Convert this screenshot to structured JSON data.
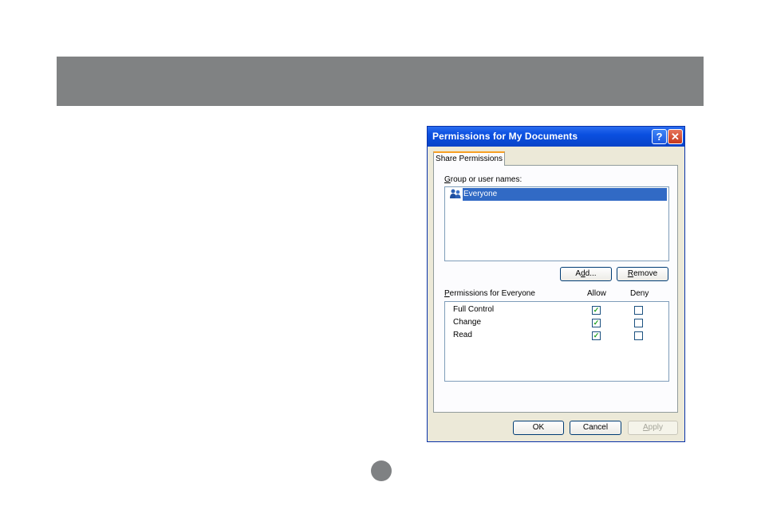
{
  "dialog": {
    "title": "Permissions for My Documents",
    "help_glyph": "?",
    "close_glyph": "✕",
    "tab_label": "Share Permissions",
    "group_label_key": "G",
    "group_label_rest": "roup or user names:",
    "users": [
      {
        "name": "Everyone",
        "icon": "user-group-icon"
      }
    ],
    "add_pre": "A",
    "add_key": "d",
    "add_post": "d...",
    "remove_key": "R",
    "remove_rest": "emove",
    "perm_label_key": "P",
    "perm_label_rest": "ermissions for Everyone",
    "col_allow": "Allow",
    "col_deny": "Deny",
    "permissions": [
      {
        "name": "Full Control",
        "allow": true,
        "deny": false
      },
      {
        "name": "Change",
        "allow": true,
        "deny": false
      },
      {
        "name": "Read",
        "allow": true,
        "deny": false
      }
    ],
    "ok": "OK",
    "cancel": "Cancel",
    "apply_key": "A",
    "apply_rest": "pply",
    "check_glyph": "✓"
  },
  "colors": {
    "titlebar": "#0a4fe0",
    "selection": "#316ac5",
    "header_bar": "#808283",
    "check": "#21a121"
  }
}
